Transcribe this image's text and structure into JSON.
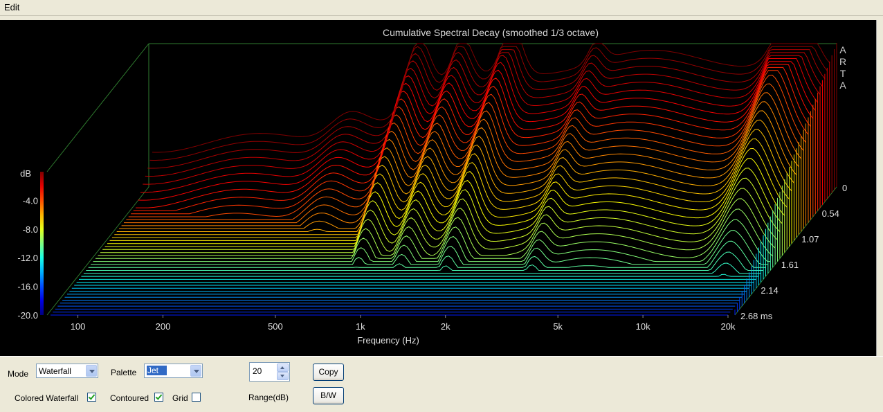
{
  "menu": {
    "edit": "Edit"
  },
  "plot": {
    "title": "Cumulative Spectral Decay (smoothed 1/3 octave)",
    "brand": [
      "A",
      "R",
      "T",
      "A"
    ],
    "y_unit": "dB",
    "y_ticks": [
      "-4.0",
      "-8.0",
      "-12.0",
      "-16.0",
      "-20.0"
    ],
    "x_ticks": [
      "100",
      "200",
      "500",
      "1k",
      "2k",
      "5k",
      "10k",
      "20k"
    ],
    "x_label": "Frequency (Hz)",
    "z_ticks": [
      "0",
      "0.54",
      "1.07",
      "1.61",
      "2.14",
      "2.68 ms"
    ]
  },
  "chart_data": {
    "type": "waterfall",
    "title": "Cumulative Spectral Decay (smoothed 1/3 octave)",
    "xlabel": "Frequency (Hz)",
    "ylabel": "dB",
    "x_scale": "log",
    "xlim": [
      80,
      20000
    ],
    "ylim": [
      -20,
      0
    ],
    "ticks_ms": [
      0,
      0.54,
      1.07,
      1.61,
      2.14,
      2.68
    ],
    "palette": "Jet",
    "slices": 44
  },
  "controls": {
    "mode_label": "Mode",
    "mode_value": "Waterfall",
    "palette_label": "Palette",
    "palette_value": "Jet",
    "range_value": "20",
    "range_label": "Range(dB)",
    "copy_label": "Copy",
    "bw_label": "B/W",
    "colored_waterfall_label": "Colored Waterfall",
    "contoured_label": "Contoured",
    "grid_label": "Grid",
    "colored_waterfall_checked": true,
    "contoured_checked": true,
    "grid_checked": false
  }
}
